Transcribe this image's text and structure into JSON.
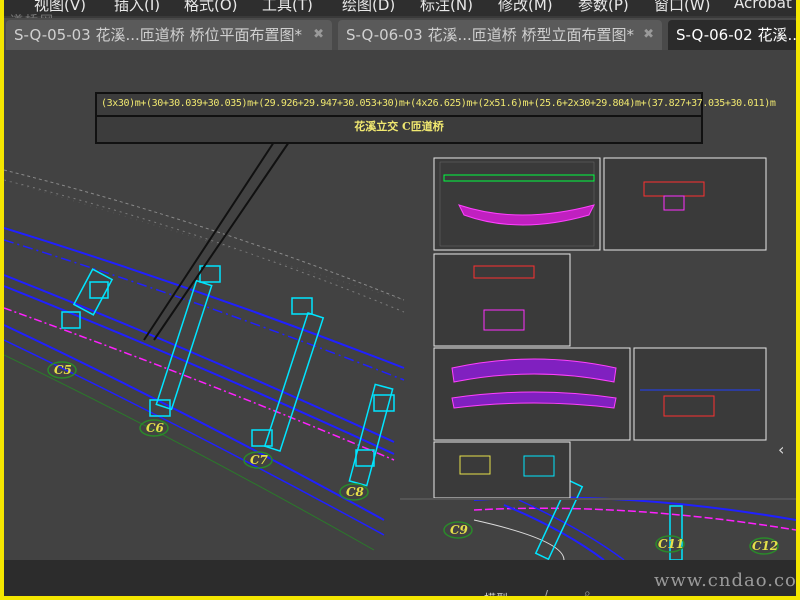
{
  "menubar": {
    "items": [
      "视图(V)",
      "插入(I)",
      "格式(O)",
      "工具(T)",
      "绘图(D)",
      "标注(N)",
      "修改(M)",
      "参数(P)",
      "窗口(W)",
      "Acrobat"
    ]
  },
  "watermark_top": "道桥网",
  "tabs": [
    {
      "label": "S-Q-05-03 花溪...匝道桥 桥位平面布置图*",
      "close": "✖"
    },
    {
      "label": "S-Q-06-03 花溪...匝道桥 桥型立面布置图*",
      "close": "✖"
    },
    {
      "label": "S-Q-06-02 花溪...",
      "close": ""
    }
  ],
  "callout": {
    "line1": "(3x30)m+(30+30.039+30.035)m+(29.926+29.947+30.053+30)m+(4x26.625)m+(2x51.6)m+(25.6+2x30+29.804)m+(37.827+37.035+30.011)m",
    "line2": "花溪立交 C匝道桥"
  },
  "pier_labels": [
    "C5",
    "C6",
    "C7",
    "C8",
    "C9",
    "C11",
    "C12"
  ],
  "statusbar": {
    "model_label": "模型",
    "slash": "/"
  },
  "watermark_bottom": "www.cndao.com",
  "colors": {
    "road_blue": "#2020ff",
    "pier_cyan": "#00e5ff",
    "centerline_magenta": "#ff20ff",
    "label_yellow": "#e6e04a",
    "sheet_border": "#e8e8e8",
    "frame_yellow": "#f4e600"
  },
  "icons": [
    "close-icon",
    "right-arrow-icon"
  ]
}
